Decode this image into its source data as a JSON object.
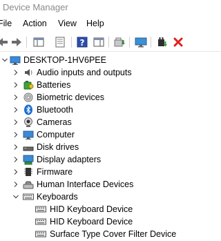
{
  "window": {
    "title": "Device Manager"
  },
  "menu": [
    "File",
    "Action",
    "View",
    "Help"
  ],
  "toolbar": {
    "buttons": [
      "back-arrow-icon",
      "forward-arrow-icon",
      "show-hide-tree-icon",
      "properties-icon",
      "help-icon",
      "action-pane-icon",
      "update-driver-icon",
      "scan-hardware-icon",
      "enable-device-icon",
      "uninstall-device-icon"
    ]
  },
  "tree": {
    "root": "DESKTOP-1HV6PEE",
    "categories": [
      "Audio inputs and outputs",
      "Batteries",
      "Biometric devices",
      "Bluetooth",
      "Cameras",
      "Computer",
      "Disk drives",
      "Display adapters",
      "Firmware",
      "Human Interface Devices",
      "Keyboards"
    ],
    "keyboards": [
      "HID Keyboard Device",
      "HID Keyboard Device",
      "Surface Type Cover Filter Device"
    ]
  }
}
